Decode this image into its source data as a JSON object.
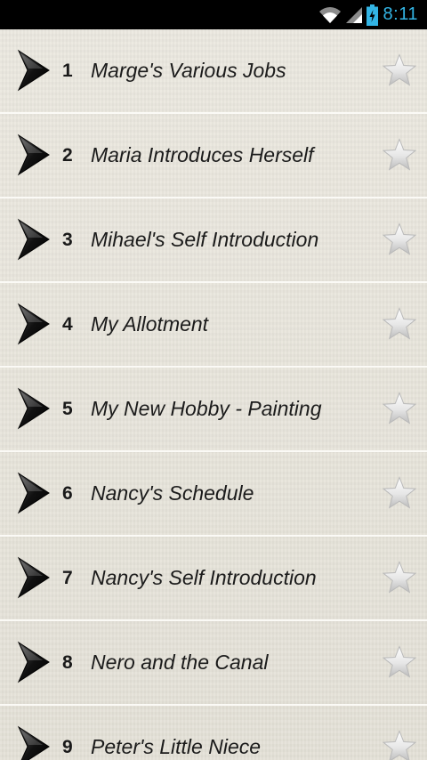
{
  "status_bar": {
    "time": "8:11",
    "icons": [
      "wifi-icon",
      "signal-icon",
      "battery-charging-icon"
    ],
    "accent_color": "#33b5e5"
  },
  "list": {
    "items": [
      {
        "number": "1",
        "title": "Marge's Various Jobs",
        "favorite": false
      },
      {
        "number": "2",
        "title": "Maria Introduces Herself",
        "favorite": false
      },
      {
        "number": "3",
        "title": "Mihael's Self Introduction",
        "favorite": false
      },
      {
        "number": "4",
        "title": "My Allotment",
        "favorite": false
      },
      {
        "number": "5",
        "title": "My New Hobby - Painting",
        "favorite": false
      },
      {
        "number": "6",
        "title": "Nancy's Schedule",
        "favorite": false
      },
      {
        "number": "7",
        "title": "Nancy's Self Introduction",
        "favorite": false
      },
      {
        "number": "8",
        "title": "Nero and the Canal",
        "favorite": false
      },
      {
        "number": "9",
        "title": "Peter's Little Niece",
        "favorite": false
      }
    ],
    "item_icon": "chevron-right-icon",
    "favorite_icon": "star-icon"
  }
}
